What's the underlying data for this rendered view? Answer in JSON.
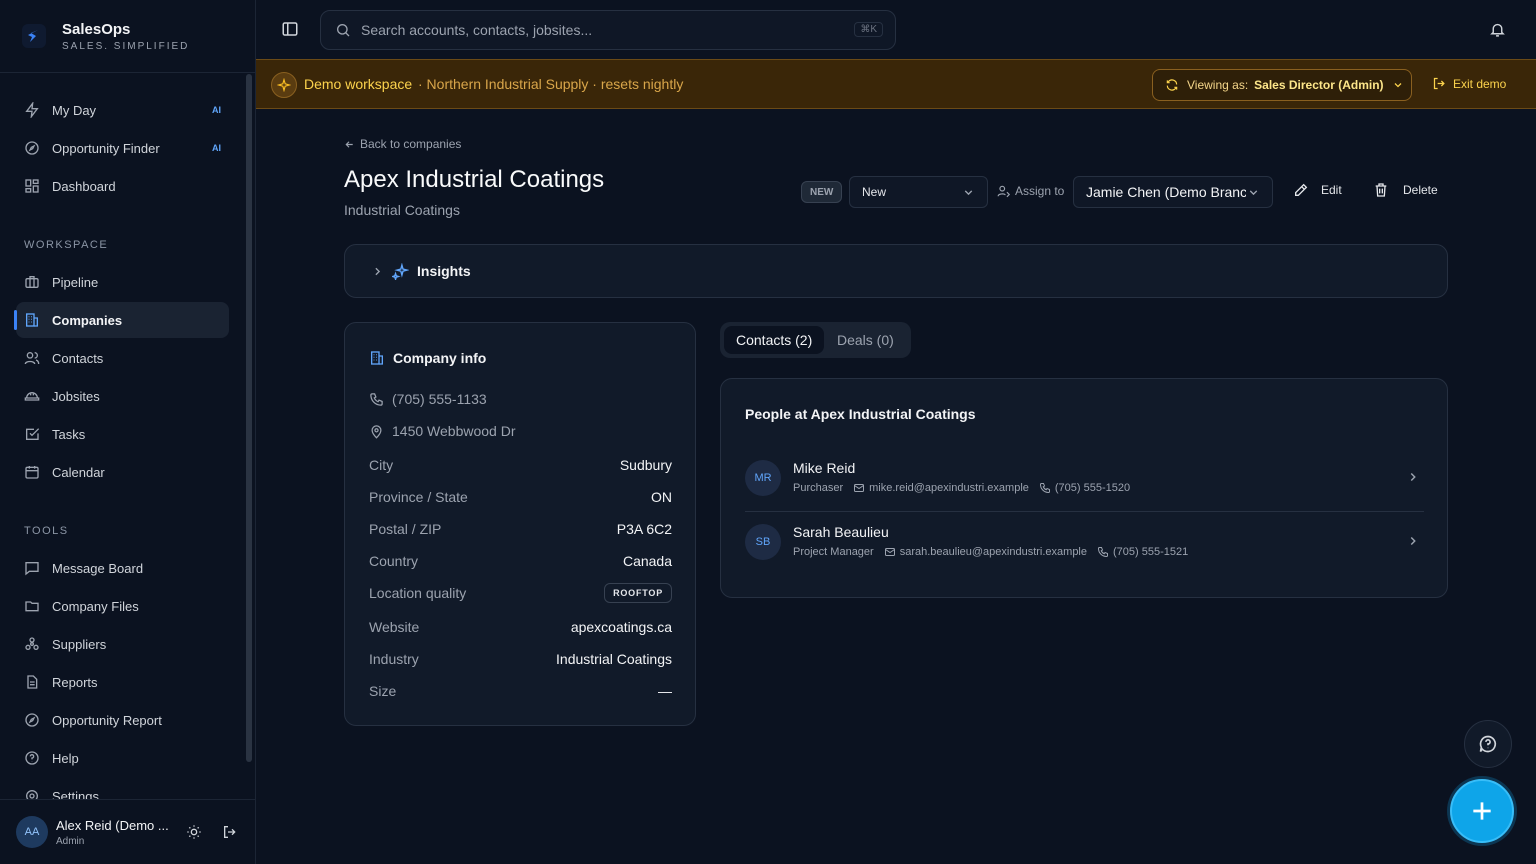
{
  "brand": {
    "name": "SalesOps",
    "tagline": "SALES. SIMPLIFIED"
  },
  "sidebar": {
    "main_items": [
      {
        "label": "My Day",
        "icon": "zap-icon",
        "badge": "AI"
      },
      {
        "label": "Opportunity Finder",
        "icon": "compass-icon",
        "badge": "AI"
      },
      {
        "label": "Dashboard",
        "icon": "grid-icon"
      }
    ],
    "workspace_label": "WORKSPACE",
    "workspace_items": [
      {
        "label": "Pipeline",
        "icon": "briefcase-icon"
      },
      {
        "label": "Companies",
        "icon": "building-icon",
        "active": true
      },
      {
        "label": "Contacts",
        "icon": "users-icon"
      },
      {
        "label": "Jobsites",
        "icon": "hardhat-icon"
      },
      {
        "label": "Tasks",
        "icon": "checkbox-icon"
      },
      {
        "label": "Calendar",
        "icon": "calendar-icon"
      }
    ],
    "tools_label": "TOOLS",
    "tools_items": [
      {
        "label": "Message Board",
        "icon": "message-icon"
      },
      {
        "label": "Company Files",
        "icon": "folder-icon"
      },
      {
        "label": "Suppliers",
        "icon": "network-icon"
      },
      {
        "label": "Reports",
        "icon": "file-icon"
      },
      {
        "label": "Opportunity Report",
        "icon": "compass-icon"
      },
      {
        "label": "Help",
        "icon": "help-icon"
      },
      {
        "label": "Settings",
        "icon": "gear-icon"
      }
    ],
    "user": {
      "initials": "AA",
      "name": "Alex Reid (Demo ...",
      "role": "Admin"
    }
  },
  "topbar": {
    "search_placeholder": "Search accounts, contacts, jobsites...",
    "shortcut": "⌘K"
  },
  "banner": {
    "title": "Demo workspace",
    "subtitle": "· Northern Industrial Supply · resets nightly",
    "viewing_label": "Viewing as:",
    "viewing_value": "Sales Director (Admin)",
    "exit_label": "Exit demo"
  },
  "company": {
    "back_label": "Back to companies",
    "name": "Apex Industrial Coatings",
    "industry_sub": "Industrial Coatings",
    "status_badge": "NEW",
    "status_value": "New",
    "assign_label": "Assign to",
    "assignee": "Jamie Chen (Demo Branch Manager)",
    "edit_label": "Edit",
    "delete_label": "Delete"
  },
  "insights": {
    "label": "Insights"
  },
  "info": {
    "title": "Company info",
    "phone": "(705) 555-1133",
    "address": "1450 Webbwood Dr",
    "rows": [
      {
        "key": "City",
        "value": "Sudbury"
      },
      {
        "key": "Province / State",
        "value": "ON"
      },
      {
        "key": "Postal / ZIP",
        "value": "P3A 6C2"
      },
      {
        "key": "Country",
        "value": "Canada"
      },
      {
        "key": "Location quality",
        "value": "ROOFTOP"
      },
      {
        "key": "Website",
        "value": "apexcoatings.ca"
      },
      {
        "key": "Industry",
        "value": "Industrial Coatings"
      },
      {
        "key": "Size",
        "value": "—"
      }
    ]
  },
  "tabs": [
    {
      "label": "Contacts (2)",
      "active": true
    },
    {
      "label": "Deals (0)",
      "active": false
    }
  ],
  "people": {
    "title": "People at Apex Industrial Coatings",
    "list": [
      {
        "initials": "MR",
        "name": "Mike Reid",
        "role": "Purchaser",
        "email": "mike.reid@apexindustri.example",
        "phone": "(705) 555-1520"
      },
      {
        "initials": "SB",
        "name": "Sarah Beaulieu",
        "role": "Project Manager",
        "email": "sarah.beaulieu@apexindustri.example",
        "phone": "(705) 555-1521"
      }
    ]
  },
  "colors": {
    "accent": "#3b82f6",
    "banner_bg": "#3a2608",
    "banner_text": "#fcd34d",
    "fab": "#0ea5e9",
    "background": "#0b1220"
  }
}
